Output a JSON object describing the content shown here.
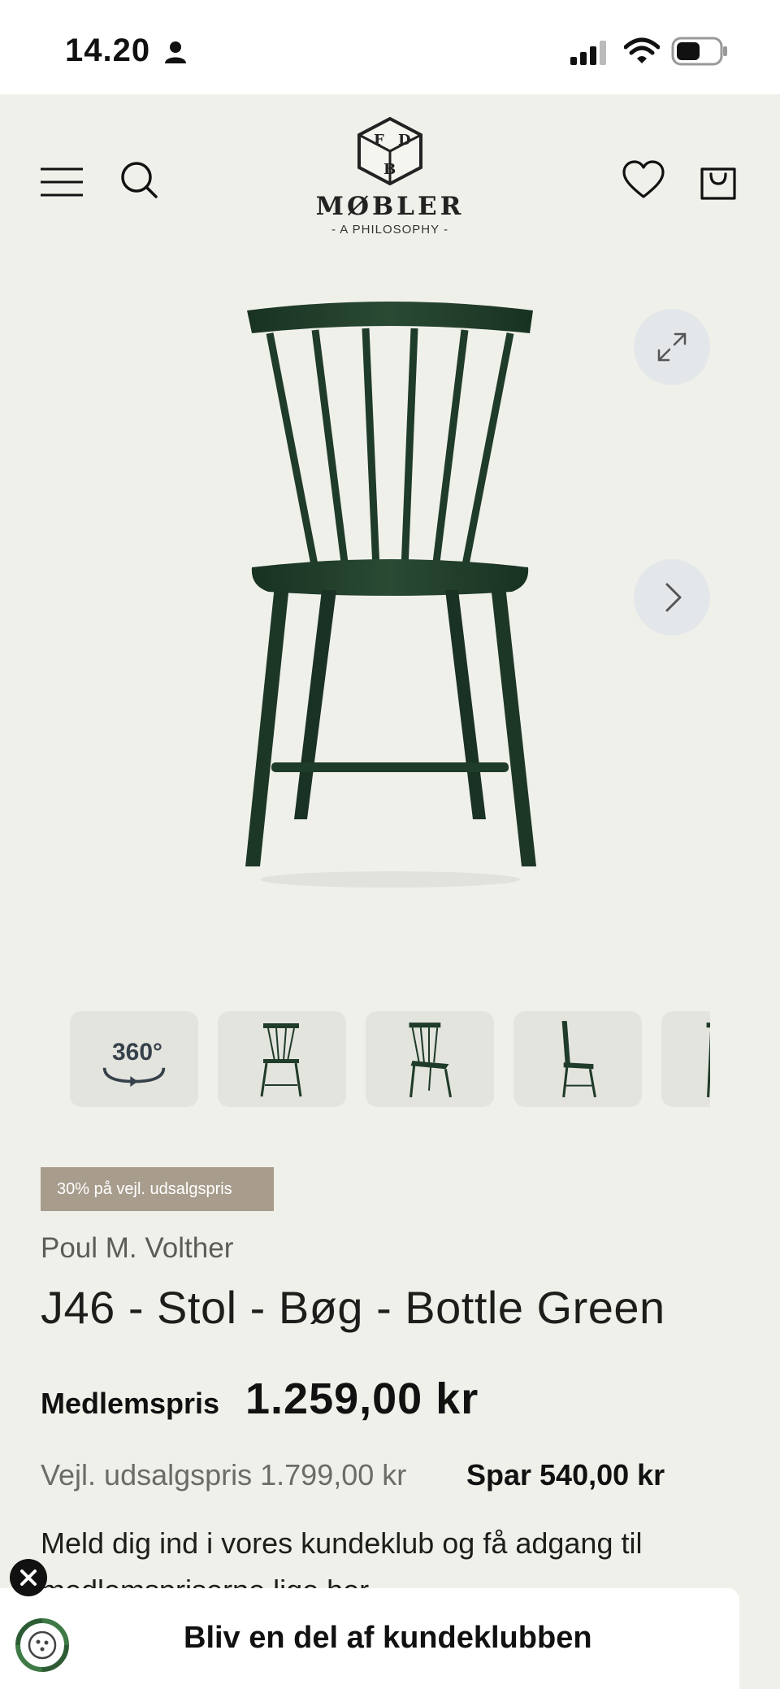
{
  "status_bar": {
    "time": "14.20"
  },
  "header": {
    "logo": {
      "mark_letters": [
        "F",
        "D",
        "B"
      ],
      "name": "MØBLER",
      "tagline": "- A PHILOSOPHY -"
    }
  },
  "gallery": {
    "thumbnails": [
      {
        "label": "360°"
      },
      {
        "label": "front"
      },
      {
        "label": "angle"
      },
      {
        "label": "side"
      },
      {
        "label": "back"
      }
    ]
  },
  "product": {
    "badge": "30% på vejl. udsalgspris",
    "designer": "Poul M. Volther",
    "title": "J46 - Stol - Bøg - Bottle Green",
    "member_label": "Medlemspris",
    "member_price": "1.259,00 kr",
    "rrp": "Vejl. udsalgspris 1.799,00 kr",
    "save": "Spar 540,00 kr",
    "club_text": "Meld dig ind i vores kundeklub og få adgang til medlemspriserne lige her"
  },
  "club_bar": {
    "label": "Bliv en del af kundeklubben"
  },
  "colors": {
    "background": "#f0f0eb",
    "badge": "#a89d8d",
    "chair_green": "#1f3b29",
    "round_button": "#e4e7ea"
  },
  "icons": [
    "person-icon",
    "signal-icon",
    "wifi-icon",
    "battery-icon",
    "menu-icon",
    "search-icon",
    "heart-icon",
    "bag-icon",
    "expand-icon",
    "chevron-right-icon",
    "close-icon",
    "club-logo-icon"
  ]
}
